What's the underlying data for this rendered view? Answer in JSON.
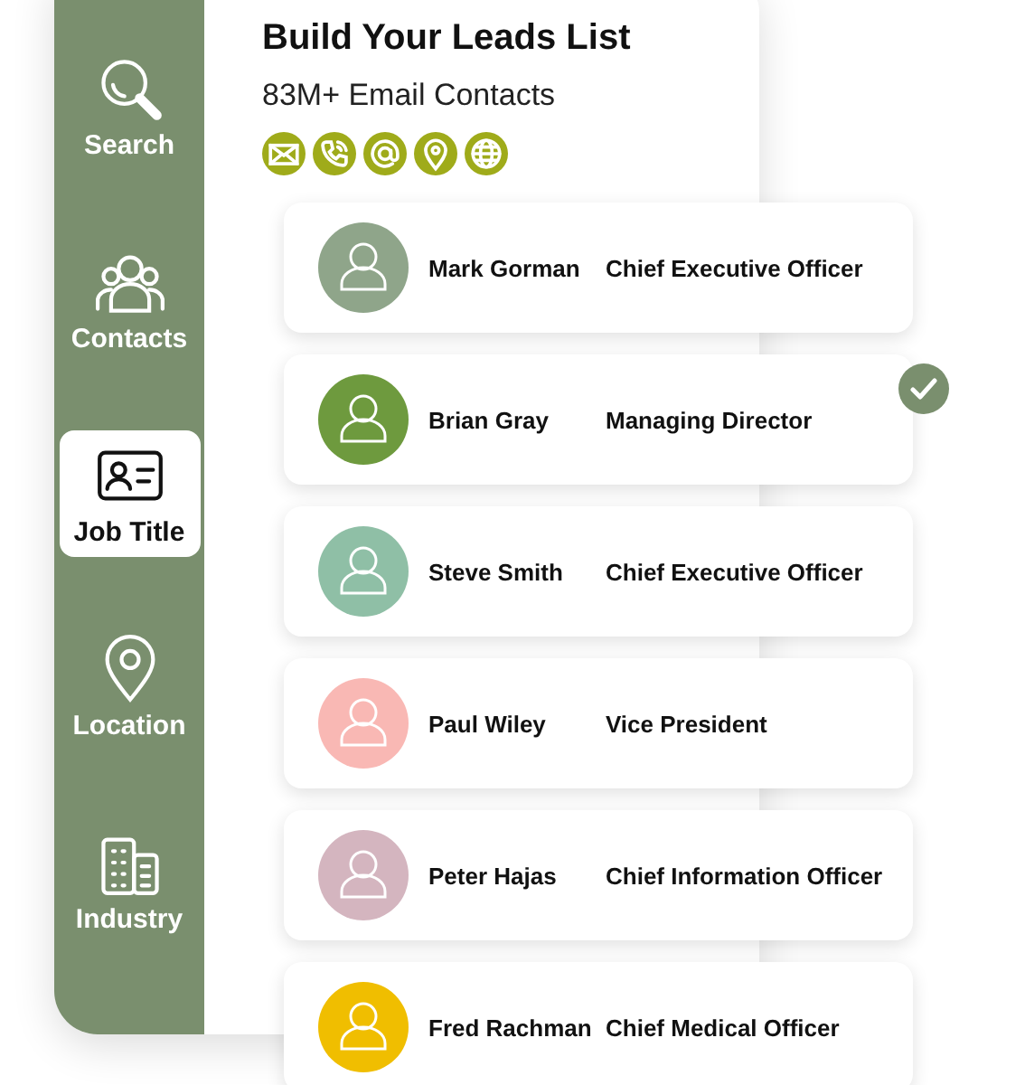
{
  "sidebar": {
    "items": [
      {
        "label": "Search",
        "selected": false
      },
      {
        "label": "Contacts",
        "selected": false
      },
      {
        "label": "Job Title",
        "selected": true
      },
      {
        "label": "Location",
        "selected": false
      },
      {
        "label": "Industry",
        "selected": false
      }
    ]
  },
  "header": {
    "title": "Build Your Leads List",
    "subtitle": "83M+ Email Contacts"
  },
  "contacts": [
    {
      "name": "Mark Gorman",
      "title": "Chief Executive Officer",
      "color": "#8fa58a",
      "checked": false
    },
    {
      "name": "Brian Gray",
      "title": "Managing Director",
      "color": "#6e9a3e",
      "checked": true
    },
    {
      "name": "Steve Smith",
      "title": "Chief Executive Officer",
      "color": "#8fbfa6",
      "checked": false
    },
    {
      "name": "Paul Wiley",
      "title": "Vice President",
      "color": "#f9b8b4",
      "checked": false
    },
    {
      "name": "Peter Hajas",
      "title": "Chief Information Officer",
      "color": "#d4b5bf",
      "checked": false
    },
    {
      "name": "Fred Rachman",
      "title": "Chief Medical Officer",
      "color": "#f0be00",
      "checked": false
    }
  ]
}
